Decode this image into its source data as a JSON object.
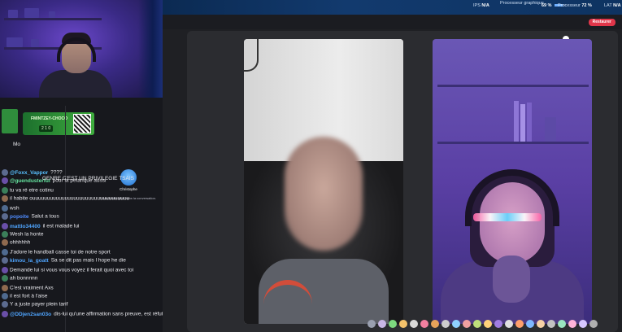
{
  "topbar": {
    "stats": [
      {
        "label": "IPS",
        "value": "N/A"
      },
      {
        "label": "Processeur graphique",
        "value": "69 %",
        "fill": 0.69
      },
      {
        "label": "Processeur",
        "value": "72 %",
        "fill": 0.72
      },
      {
        "label": "LAT",
        "value": "N/A"
      }
    ],
    "reset_label": "Restaurer"
  },
  "chat": {
    "qr_card": {
      "label": "FMINTZEY-CHOCO",
      "date": "2 1 0"
    },
    "header_name": "Mo",
    "messages": [
      {
        "user": "@Foxx_Vappor",
        "text": "????",
        "color": "#58c0ff"
      },
      {
        "user": "@guendusterful",
        "text": "pour la petanque aussi",
        "color": "#66e6a1"
      },
      {
        "user": "",
        "text": "tu va ré etre cotinu",
        "color": "#ffffff"
      },
      {
        "user": "",
        "text": "il habite ouuuuuuuuuuuuuuuuuuuuuuuuuuuuuuuuu",
        "color": "#ffffff"
      },
      {
        "user": "",
        "text": "wsh",
        "color": "#ffffff"
      },
      {
        "user": "popoite",
        "text": "Salut a tous",
        "color": "#4f8cff"
      },
      {
        "user": "mattlo34400",
        "text": "il est malade lui",
        "color": "#4fa5ff"
      },
      {
        "user": "",
        "text": "Wesh la honte",
        "color": "#ffffff"
      },
      {
        "user": "",
        "text": "ohhhhhh",
        "color": "#ffffff"
      },
      {
        "user": "",
        "text": "J'adore le handball casse toi de notre sport",
        "color": "#ffffff"
      },
      {
        "user": "kimou_la_goatt",
        "text": "Sa se dit pas mais l hope he die",
        "color": "#4fa5ff"
      },
      {
        "user": "",
        "text": "Demande lui si vous vous voyez il ferait quoi avec toi",
        "color": "#ffffff"
      },
      {
        "user": "",
        "text": "ah bonnnnn",
        "color": "#ffffff"
      },
      {
        "user": "",
        "text": "C'est vraiment Axs",
        "color": "#ffffff"
      },
      {
        "user": "",
        "text": "il est fort à l'aise",
        "color": "#ffffff"
      },
      {
        "user": "",
        "text": "Y a juste payer plein tarif",
        "color": "#ffffff"
      },
      {
        "user": "@DDjen2san03o",
        "text": "dis-lui qu'une affirmation sans preuve, est réfutable sans preuve @dannyzyy",
        "color": "#4fa5ff"
      }
    ],
    "genre_line": "GENRE C'EST UN PRIVILEGIE TSAIS",
    "genre_user": "",
    "christophe": {
      "name": "Christophe",
      "subtitle": "Vous n'êtes plus dans la conversation."
    }
  },
  "dock": {
    "emoji_colors": [
      "#9aa0b0",
      "#c9b7e6",
      "#7dd97f",
      "#f4c26b",
      "#d9d9d9",
      "#f27fa0",
      "#e6a35a",
      "#cccccc",
      "#8fd1ff",
      "#f0a0a0",
      "#bde07a",
      "#ffd27a",
      "#a07de0",
      "#e0e0e0",
      "#ff9f6b",
      "#7fb8ff",
      "#f7d2a6",
      "#c2c2c2",
      "#9be6c0",
      "#ffb3d9",
      "#d6c7ff",
      "#b0b0b0"
    ]
  }
}
